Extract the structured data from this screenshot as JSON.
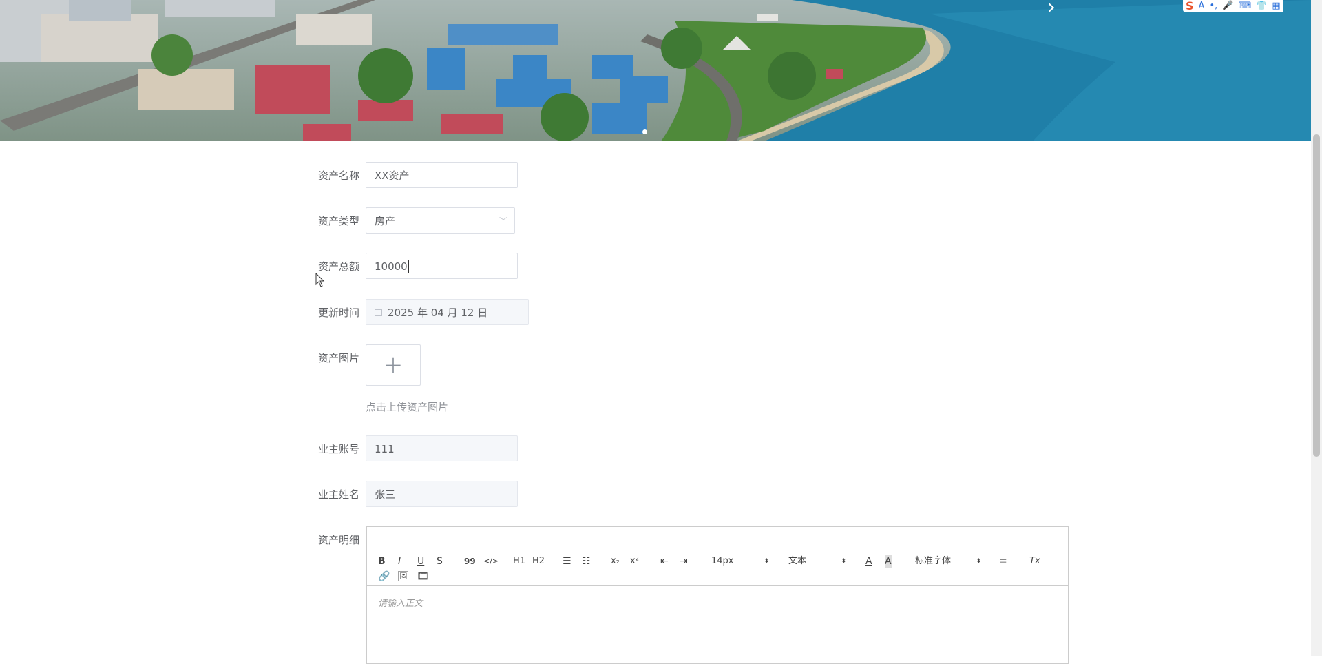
{
  "form": {
    "asset_name": {
      "label": "资产名称",
      "value": "XX资产"
    },
    "asset_type": {
      "label": "资产类型",
      "value": "房产"
    },
    "asset_total": {
      "label": "资产总额",
      "value": "10000"
    },
    "update_time": {
      "label": "更新时间",
      "value": "2025 年 04 月 12 日"
    },
    "asset_image": {
      "label": "资产图片",
      "tip": "点击上传资产图片"
    },
    "owner_account": {
      "label": "业主账号",
      "value": "111"
    },
    "owner_name": {
      "label": "业主姓名",
      "value": "张三"
    },
    "asset_detail": {
      "label": "资产明细",
      "placeholder": "请输入正文"
    }
  },
  "editor_toolbar": {
    "bold": "B",
    "italic": "I",
    "underline": "U",
    "strike": "S",
    "blockquote": "99",
    "code": "</>",
    "h1": "H1",
    "h2": "H2",
    "sub": "x₂",
    "sup": "x²",
    "size": "14px",
    "header": "文本",
    "font": "标准字体",
    "clean": "Tx"
  },
  "ime": {
    "logo": "S",
    "letter": "A"
  },
  "colors": {
    "border": "#dcdfe6",
    "disabled_bg": "#f5f7fa",
    "sea": "#1f7fa8"
  }
}
